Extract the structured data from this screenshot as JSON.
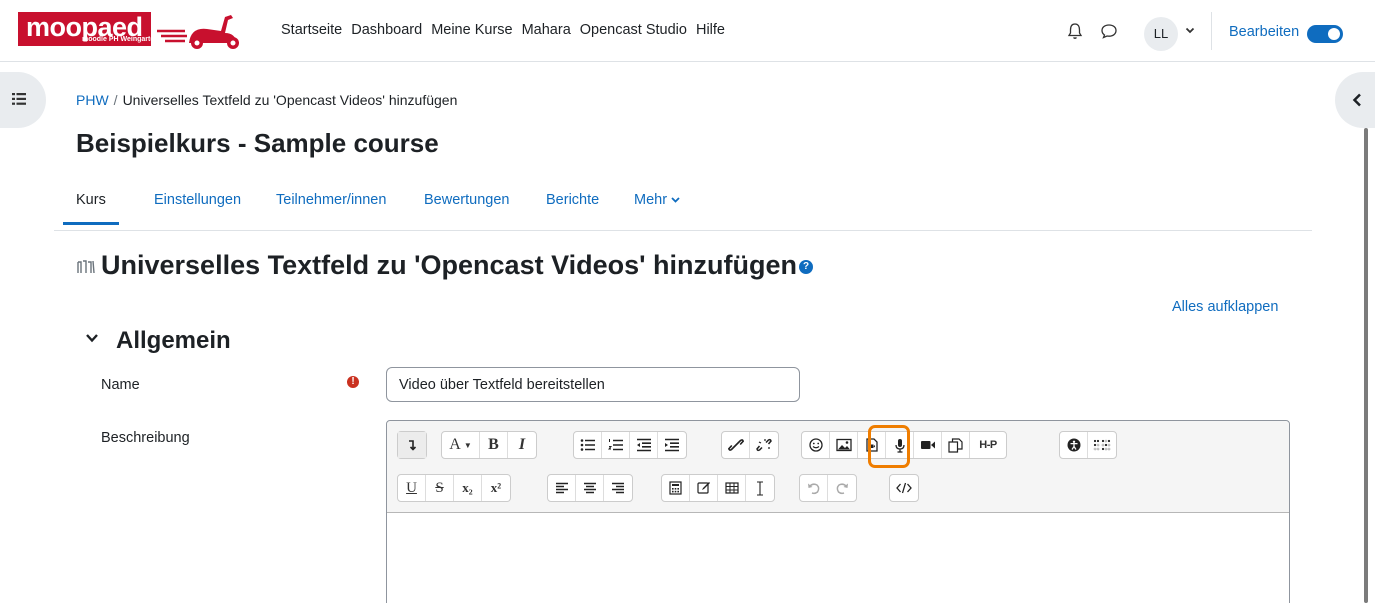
{
  "brand": {
    "logo_text": "moopaed",
    "logo_sub": "moodle PH Weingarten",
    "accent": "#0f6cbf",
    "logo_red": "#c8102e",
    "highlight": "#ef7d00"
  },
  "nav": {
    "links": [
      "Startseite",
      "Dashboard",
      "Meine Kurse",
      "Mahara",
      "Opencast Studio",
      "Hilfe"
    ],
    "avatar": "LL",
    "edit_mode_label": "Bearbeiten",
    "edit_mode_on": true
  },
  "breadcrumb": {
    "root": "PHW",
    "separator": "/",
    "current": "Universelles Textfeld zu 'Opencast Videos' hinzufügen"
  },
  "page_title": "Beispielkurs - Sample course",
  "tabs": [
    "Kurs",
    "Einstellungen",
    "Teilnehmer/innen",
    "Bewertungen",
    "Berichte",
    "Mehr"
  ],
  "activity_heading": "Universelles Textfeld zu 'Opencast Videos' hinzufügen",
  "expand_all": "Alles aufklappen",
  "section": {
    "title": "Allgemein",
    "name_label": "Name",
    "name_value": "Video über Textfeld bereitstellen",
    "description_label": "Beschreibung"
  },
  "toolbar": {
    "row1": [
      "collapse",
      "font-color",
      "bold",
      "italic",
      "unordered-list",
      "ordered-list",
      "outdent",
      "indent",
      "link",
      "unlink",
      "emoji",
      "image",
      "media",
      "record-audio",
      "record-video",
      "manage-files",
      "h5p",
      "accessibility-checker",
      "screenreader-helper"
    ],
    "row2": [
      "underline",
      "strikethrough",
      "subscript",
      "superscript",
      "align-left",
      "align-center",
      "align-right",
      "equation",
      "special-character",
      "table",
      "clear-formatting",
      "undo",
      "redo",
      "html"
    ],
    "labels": {
      "bold": "B",
      "italic": "I",
      "font_color": "A",
      "underline": "U",
      "strike": "S",
      "sub": "x₂",
      "sup": "x²",
      "h5p": "H-P"
    }
  }
}
